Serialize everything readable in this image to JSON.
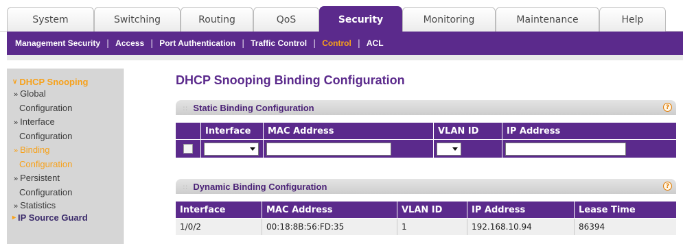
{
  "tabs": [
    {
      "label": "System"
    },
    {
      "label": "Switching"
    },
    {
      "label": "Routing"
    },
    {
      "label": "QoS"
    },
    {
      "label": "Security"
    },
    {
      "label": "Monitoring"
    },
    {
      "label": "Maintenance"
    },
    {
      "label": "Help"
    }
  ],
  "subnav": [
    {
      "label": "Management Security"
    },
    {
      "label": "Access"
    },
    {
      "label": "Port Authentication"
    },
    {
      "label": "Traffic Control"
    },
    {
      "label": "Control"
    },
    {
      "label": "ACL"
    }
  ],
  "sidebar": {
    "head": "DHCP Snooping",
    "items": [
      {
        "line1": "Global",
        "line2": "Configuration"
      },
      {
        "line1": "Interface",
        "line2": "Configuration"
      },
      {
        "line1": "Binding",
        "line2": "Configuration"
      },
      {
        "line1": "Persistent",
        "line2": "Configuration"
      },
      {
        "line1": "Statistics"
      }
    ],
    "bottom": "IP Source Guard"
  },
  "page": {
    "title": "DHCP Snooping Binding Configuration"
  },
  "static": {
    "title": "Static Binding Configuration",
    "help": "?",
    "columns": [
      "Interface",
      "MAC Address",
      "VLAN ID",
      "IP Address"
    ]
  },
  "dynamic": {
    "title": "Dynamic Binding Configuration",
    "help": "?",
    "columns": [
      "Interface",
      "MAC Address",
      "VLAN ID",
      "IP Address",
      "Lease Time"
    ],
    "rows": [
      {
        "interface": "1/0/2",
        "mac": "00:18:8B:56:FD:35",
        "vlan": "1",
        "ip": "192.168.10.94",
        "lease": "86394"
      }
    ]
  },
  "colors": {
    "accent": "#5b2a8c",
    "highlight": "#f7a11a"
  }
}
